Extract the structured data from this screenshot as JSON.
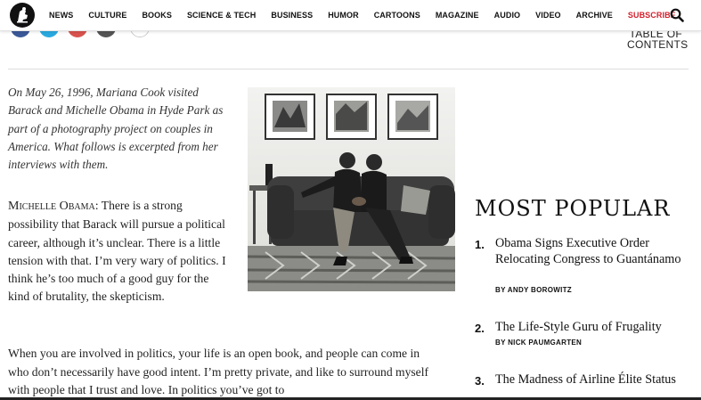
{
  "nav": {
    "items": [
      "NEWS",
      "CULTURE",
      "BOOKS",
      "SCIENCE & TECH",
      "BUSINESS",
      "HUMOR",
      "CARTOONS",
      "MAGAZINE",
      "AUDIO",
      "VIDEO",
      "ARCHIVE",
      "SUBSCRIBE"
    ],
    "subscribe_color": "#d4202c"
  },
  "share_colors": [
    "#3b5998",
    "#2aa9e0",
    "#d9534f",
    "#555555",
    "#ffffff"
  ],
  "toc": {
    "line1": "TABLE OF",
    "line2": "CONTENTS"
  },
  "article": {
    "intro": "On May 26, 1996, Mariana Cook visited Barack and Michelle Obama in Hyde Park as part of a photography project on couples in America. What follows is excerpted from her interviews with them.",
    "speaker": "Michelle Obama:",
    "para1": " There is a strong possibility that Barack will pursue a political career, although it’s unclear. There is a little tension with that. I’m very wary of politics. I think he’s too much of a good guy for the kind of brutality, the skepticism.",
    "para2": "When you are involved in politics, your life is an open book, and people can come in who don’t necessarily have good intent. I’m pretty private, and like to surround myself with people that I trust and love. In politics you’ve got to"
  },
  "most_popular": {
    "title": "MOST POPULAR",
    "items": [
      {
        "num": "1.",
        "headline": "Obama Signs Executive Order Relocating Congress to Guantánamo",
        "byline": "BY ANDY BOROWITZ"
      },
      {
        "num": "2.",
        "headline": "The Life-Style Guru of Frugality",
        "byline": "BY NICK PAUMGARTEN"
      },
      {
        "num": "3.",
        "headline": "The Madness of Airline Élite Status",
        "byline": ""
      }
    ]
  }
}
